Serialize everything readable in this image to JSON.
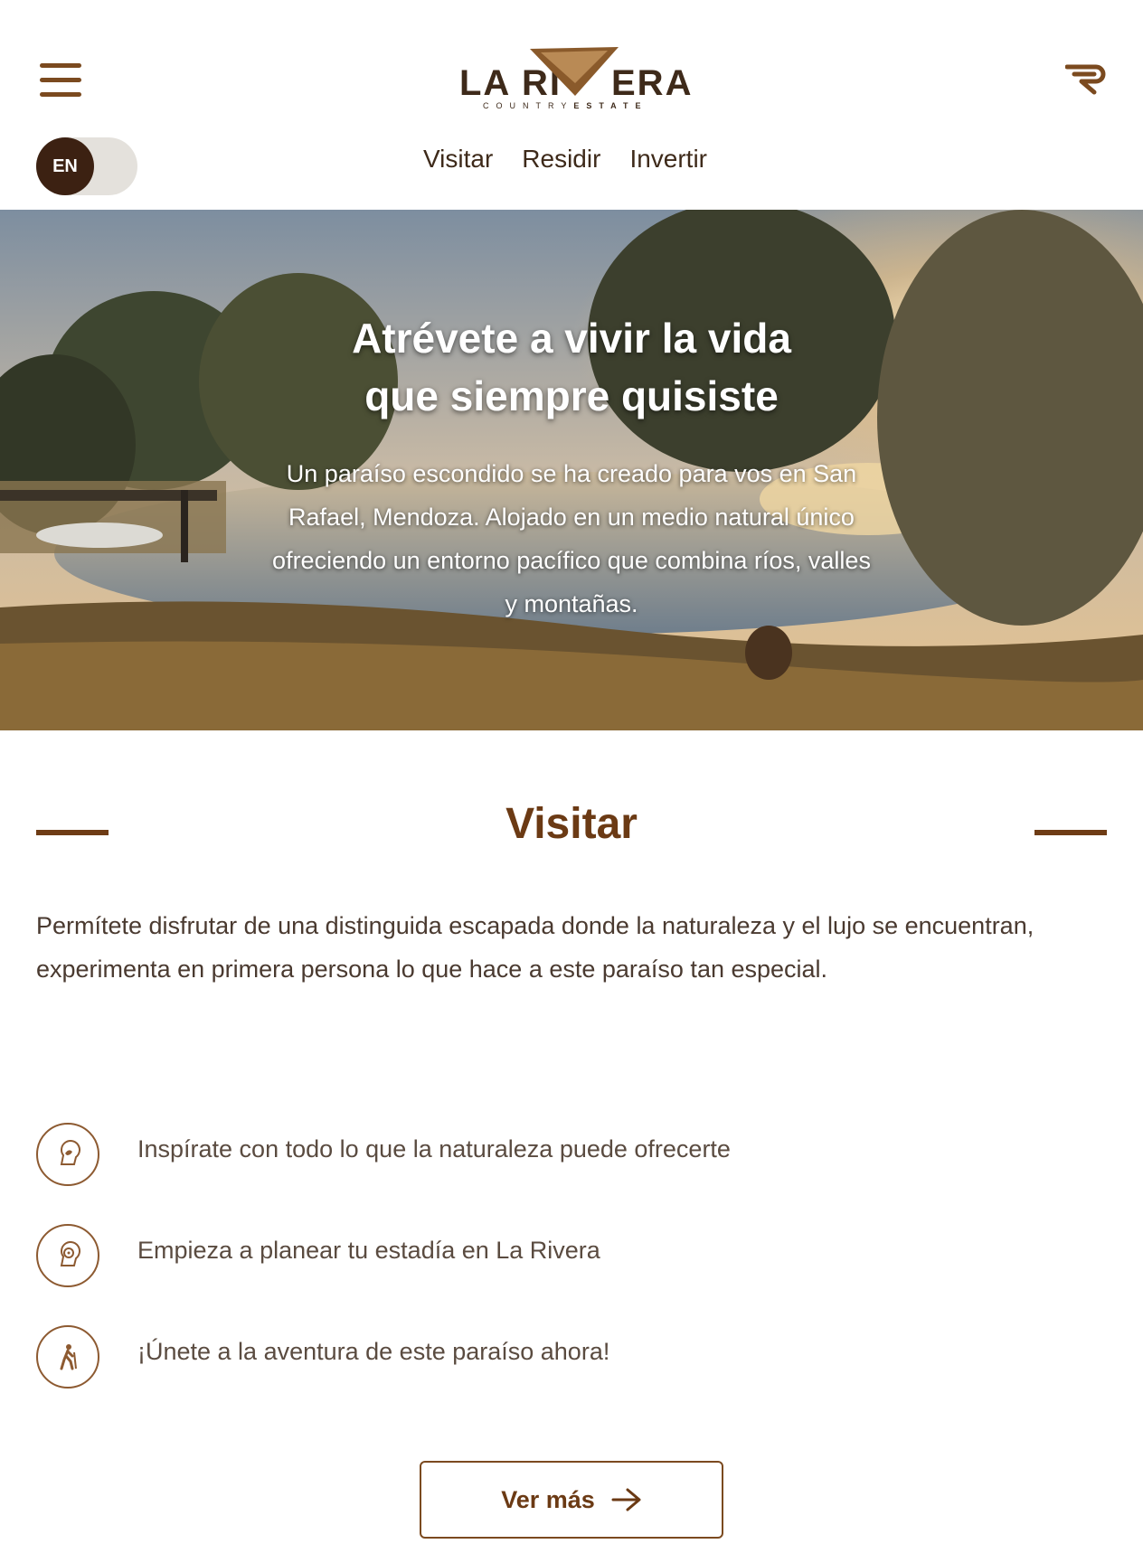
{
  "header": {
    "logo_left": "LA RI",
    "logo_right": "ERA",
    "logo_sub_light": "COUNTRY",
    "logo_sub_bold": "ESTATE",
    "lang_label": "EN",
    "nav": [
      "Visitar",
      "Residir",
      "Invertir"
    ]
  },
  "hero": {
    "title_line1": "Atrévete a vivir la vida",
    "title_line2": "que siempre quisiste",
    "text": "Un paraíso escondido se ha creado para vos en San Rafael, Mendoza. Alojado en un medio natural único ofreciendo un entorno pacífico que combina ríos, valles y montañas."
  },
  "section": {
    "title": "Visitar",
    "intro": "Permítete disfrutar de una distinguida escapada donde la naturaleza y el lujo se encuentran, experimenta en primera persona lo que hace a este paraíso tan especial.",
    "features": [
      {
        "icon": "head-nature-icon",
        "text": "Inspírate con todo lo que la naturaleza puede ofrecerte"
      },
      {
        "icon": "planning-head-icon",
        "text": "Empieza a planear tu estadía en La Rivera"
      },
      {
        "icon": "hiker-icon",
        "text": "¡Únete a la aventura de este paraíso ahora!"
      }
    ],
    "cta_label": "Ver más"
  },
  "colors": {
    "brand_brown": "#6b3a14",
    "dark_brown": "#3c2112",
    "toggle_bg": "#e4e1dc"
  }
}
